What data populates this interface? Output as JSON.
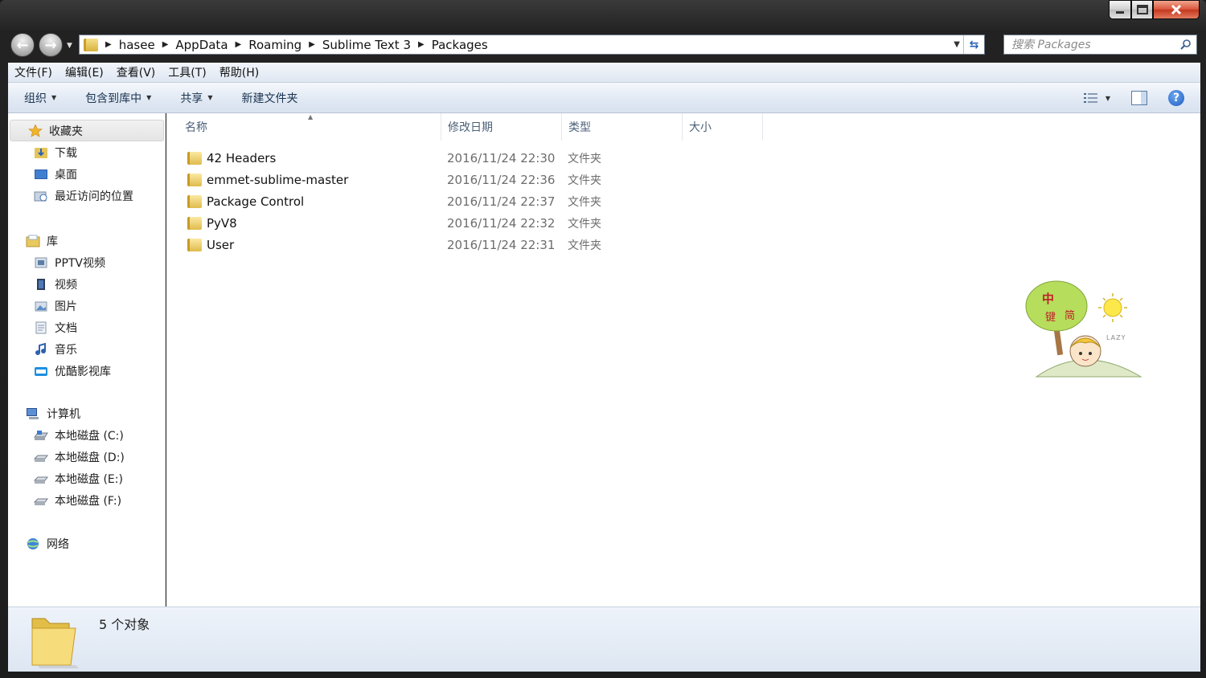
{
  "breadcrumb": [
    "hasee",
    "AppData",
    "Roaming",
    "Sublime Text 3",
    "Packages"
  ],
  "search": {
    "placeholder": "搜索 Packages"
  },
  "menu": [
    "文件(F)",
    "编辑(E)",
    "查看(V)",
    "工具(T)",
    "帮助(H)"
  ],
  "toolbar": {
    "organize": "组织",
    "include": "包含到库中",
    "share": "共享",
    "new_folder": "新建文件夹"
  },
  "sidebar": {
    "favorites": {
      "label": "收藏夹",
      "items": [
        "下载",
        "桌面",
        "最近访问的位置"
      ]
    },
    "libraries": {
      "label": "库",
      "items": [
        "PPTV视频",
        "视频",
        "图片",
        "文档",
        "音乐",
        "优酷影视库"
      ]
    },
    "computer": {
      "label": "计算机",
      "items": [
        "本地磁盘 (C:)",
        "本地磁盘 (D:)",
        "本地磁盘 (E:)",
        "本地磁盘 (F:)"
      ]
    },
    "network": {
      "label": "网络"
    }
  },
  "columns": {
    "name": "名称",
    "date": "修改日期",
    "type": "类型",
    "size": "大小"
  },
  "files": [
    {
      "name": "42 Headers",
      "date": "2016/11/24 22:30",
      "type": "文件夹"
    },
    {
      "name": "emmet-sublime-master",
      "date": "2016/11/24 22:36",
      "type": "文件夹"
    },
    {
      "name": "Package Control",
      "date": "2016/11/24 22:37",
      "type": "文件夹"
    },
    {
      "name": "PyV8",
      "date": "2016/11/24 22:32",
      "type": "文件夹"
    },
    {
      "name": "User",
      "date": "2016/11/24 22:31",
      "type": "文件夹"
    }
  ],
  "watermark": {
    "chars": [
      "中",
      "键",
      "简"
    ],
    "caption": "LAZY"
  },
  "status": {
    "count": "5 个对象"
  },
  "colors": {
    "accent": "#2b63b7",
    "window_frame": "#1d1d1d",
    "folder": "#e0bb4b"
  }
}
